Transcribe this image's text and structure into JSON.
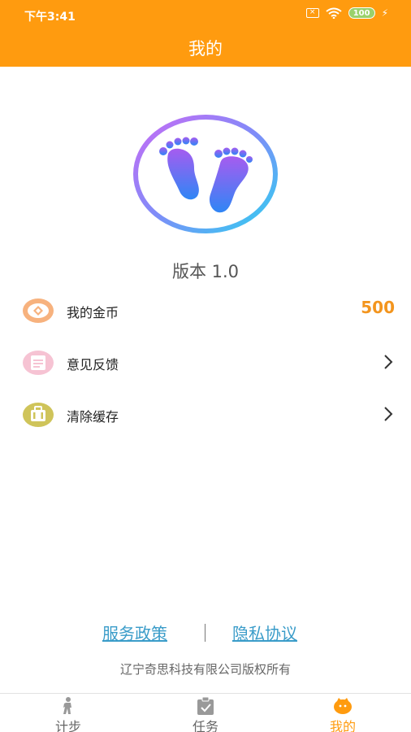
{
  "status_bar": {
    "time": "下午3:41",
    "battery": "100"
  },
  "header": {
    "title": "我的"
  },
  "app": {
    "version": "版本 1.0"
  },
  "menu": {
    "coins": {
      "label": "我的金币",
      "value": "500",
      "icon": "coin-icon"
    },
    "feedback": {
      "label": "意见反馈",
      "icon": "feedback-icon"
    },
    "clear_cache": {
      "label": "清除缓存",
      "icon": "briefcase-icon"
    }
  },
  "footer": {
    "service_policy": "服务政策",
    "privacy_agreement": "隐私协议",
    "copyright": "辽宁奇思科技有限公司版权所有"
  },
  "tabs": [
    {
      "label": "计步",
      "icon": "walking-person-icon",
      "active": false
    },
    {
      "label": "任务",
      "icon": "task-clipboard-icon",
      "active": false
    },
    {
      "label": "我的",
      "icon": "face-icon",
      "active": true
    }
  ],
  "colors": {
    "accent": "#FF9B0F",
    "coin_value": "#F3951E",
    "link": "#3A9CC9"
  }
}
